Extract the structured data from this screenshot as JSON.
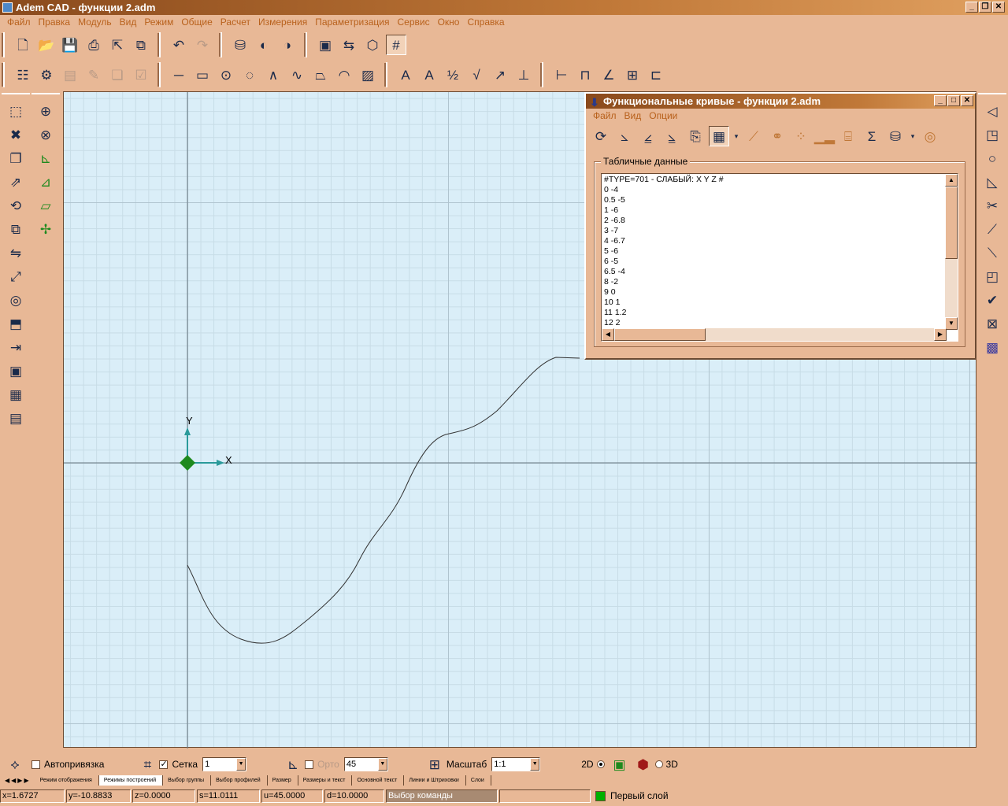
{
  "app": {
    "title": "Adem CAD - функции 2.adm"
  },
  "menu": [
    "Файл",
    "Правка",
    "Модуль",
    "Вид",
    "Режим",
    "Общие",
    "Расчет",
    "Измерения",
    "Параметризация",
    "Сервис",
    "Окно",
    "Справка"
  ],
  "canvas": {
    "axis_x_label": "X",
    "axis_y_label": "Y"
  },
  "func_window": {
    "title": "Функциональные кривые - функции 2.adm",
    "menu": [
      "Файл",
      "Вид",
      "Опции"
    ],
    "group_label": "Табличные данные",
    "rows": [
      "#TYPE=701 - СЛАБЫЙ: X Y Z #",
      "0 -4",
      "0.5 -5",
      "1 -6",
      "2 -6.8",
      "3 -7",
      "4 -6.7",
      "5 -6",
      "6 -5",
      "6.5 -4",
      "8 -2",
      "9 0",
      "10 1",
      "11 1.2",
      "12 2"
    ]
  },
  "bottom": {
    "autosnap_label": "Автопривязка",
    "grid_label": "Сетка",
    "grid_value": "1",
    "ortho_label": "Орто",
    "ortho_value": "45",
    "scale_label": "Масштаб",
    "scale_value": "1:1",
    "mode_2d": "2D",
    "mode_3d": "3D"
  },
  "tabs": [
    "Режим отображения",
    "Режимы построений",
    "Выбор группы",
    "Выбор профилей",
    "Размер",
    "Размеры и текст",
    "Основной текст",
    "Линии и Штриховки",
    "Слои"
  ],
  "status": {
    "x": "x=1.6727",
    "y": "y=-10.8833",
    "z": "z=0.0000",
    "s": "s=11.0111",
    "u": "u=45.0000",
    "d": "d=10.0000",
    "command": "Выбор команды",
    "layer": "Первый слой"
  },
  "colors": {
    "accent": "#b8611c",
    "canvas": "#daeef8",
    "layer": "#00b000",
    "origin": "#1e8a1e"
  }
}
